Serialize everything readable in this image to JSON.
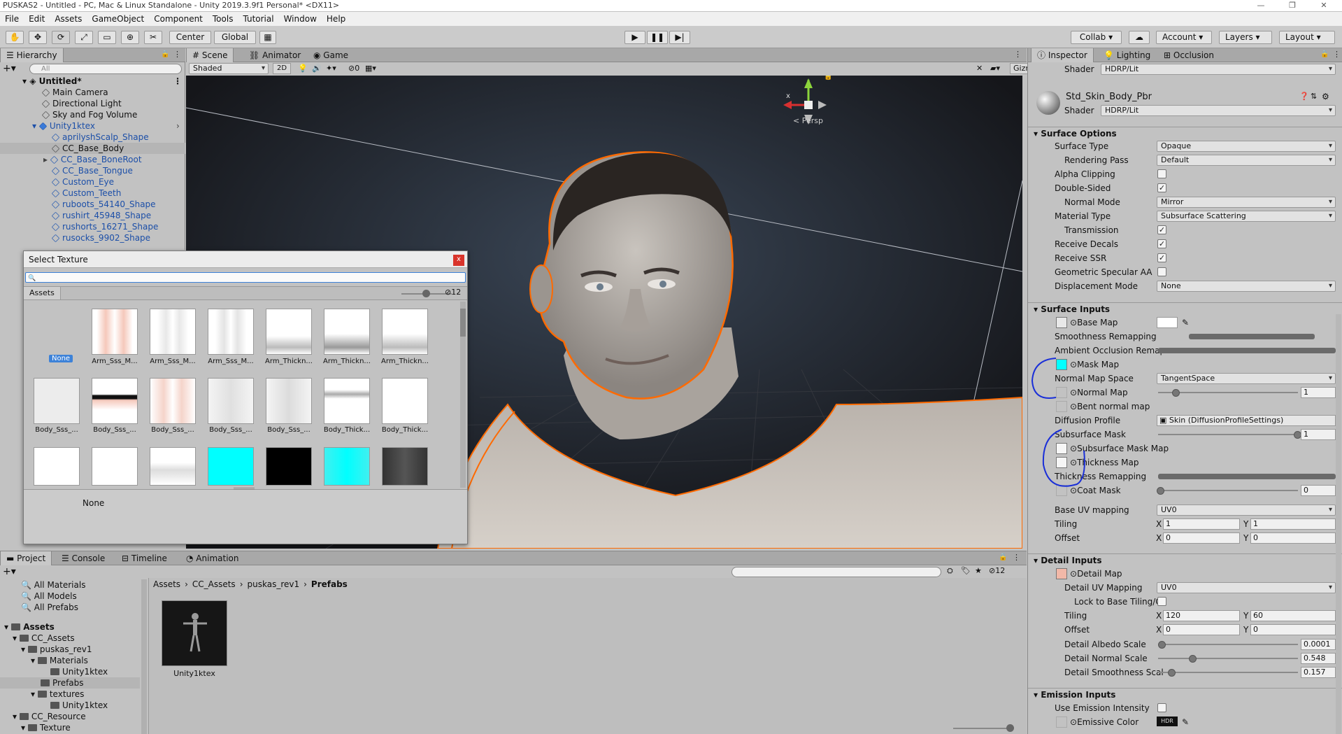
{
  "window": {
    "title": "PUSKAS2 - Untitled - PC, Mac & Linux Standalone - Unity 2019.3.9f1 Personal* <DX11>",
    "controls": [
      "—",
      "❐",
      "✕"
    ]
  },
  "menu": [
    "File",
    "Edit",
    "Assets",
    "GameObject",
    "Component",
    "Tools",
    "Tutorial",
    "Window",
    "Help"
  ],
  "toolbar": {
    "pivot": "Center",
    "space": "Global",
    "collab": "Collab ▾",
    "account": "Account",
    "layers": "Layers",
    "layout": "Layout"
  },
  "hierarchy": {
    "tab": "Hierarchy",
    "search_placeholder": "All",
    "scene": "Untitled*",
    "items": [
      {
        "label": "Main Camera",
        "blue": false
      },
      {
        "label": "Directional Light",
        "blue": false
      },
      {
        "label": "Sky and Fog Volume",
        "blue": false
      },
      {
        "label": "Unity1ktex",
        "blue": true
      },
      {
        "label": "aprilyshScalp_Shape",
        "blue": true
      },
      {
        "label": "CC_Base_Body",
        "blue": false
      },
      {
        "label": "CC_Base_BoneRoot",
        "blue": true
      },
      {
        "label": "CC_Base_Tongue",
        "blue": true
      },
      {
        "label": "Custom_Eye",
        "blue": true
      },
      {
        "label": "Custom_Teeth",
        "blue": true
      },
      {
        "label": "ruboots_54140_Shape",
        "blue": true
      },
      {
        "label": "rushirt_45948_Shape",
        "blue": true
      },
      {
        "label": "rushorts_16271_Shape",
        "blue": true
      },
      {
        "label": "rusocks_9902_Shape",
        "blue": true
      }
    ]
  },
  "scene_tabs": {
    "scene": "Scene",
    "animator": "Animator",
    "game": "Game",
    "shading": "Shaded",
    "mode_2d": "2D",
    "hidden_count": "0",
    "gizmos": "Gizmos",
    "search_placeholder": "All",
    "persp": "< Persp",
    "axis_x": "x",
    "axis_y": "y"
  },
  "dialog": {
    "title": "Select Texture",
    "close": "x",
    "assets_tab": "Assets",
    "count": "12",
    "selected_label": "None",
    "thumbnails": [
      {
        "label": "None",
        "selected": true
      },
      {
        "label": "Arm_Sss_M..."
      },
      {
        "label": "Arm_Sss_M..."
      },
      {
        "label": "Arm_Sss_M..."
      },
      {
        "label": "Arm_Thickn..."
      },
      {
        "label": "Arm_Thickn..."
      },
      {
        "label": "Arm_Thickn..."
      },
      {
        "label": "Body_Sss_..."
      },
      {
        "label": "Body_Sss_..."
      },
      {
        "label": "Body_Sss_..."
      },
      {
        "label": "Body_Sss_..."
      },
      {
        "label": "Body_Sss_..."
      },
      {
        "label": "Body_Thick..."
      },
      {
        "label": "Body_Thick..."
      }
    ]
  },
  "inspector": {
    "tabs": [
      "Inspector",
      "Lighting",
      "Occlusion"
    ],
    "shader_label": "Shader",
    "shader_top": "HDRP/Lit",
    "material_name": "Std_Skin_Body_Pbr",
    "shader_value": "HDRP/Lit",
    "surface_options": {
      "header": "Surface Options",
      "surface_type_label": "Surface Type",
      "surface_type": "Opaque",
      "rendering_pass_label": "Rendering Pass",
      "rendering_pass": "Default",
      "alpha_clipping_label": "Alpha Clipping",
      "double_sided_label": "Double-Sided",
      "normal_mode_label": "Normal Mode",
      "normal_mode": "Mirror",
      "material_type_label": "Material Type",
      "material_type": "Subsurface Scattering",
      "transmission_label": "Transmission",
      "receive_decals_label": "Receive Decals",
      "receive_ssr_label": "Receive SSR",
      "gsaa_label": "Geometric Specular AA",
      "displacement_label": "Displacement Mode",
      "displacement": "None"
    },
    "surface_inputs": {
      "header": "Surface Inputs",
      "base_map": "Base Map",
      "smoothness_remap": "Smoothness Remapping",
      "ao_remap": "Ambient Occlusion Remap",
      "mask_map": "Mask Map",
      "normal_space_label": "Normal Map Space",
      "normal_space": "TangentSpace",
      "normal_map": "Normal Map",
      "normal_value": "1",
      "bent_normal": "Bent normal map",
      "diffusion_label": "Diffusion Profile",
      "diffusion": "Skin (DiffusionProfileSettings)",
      "sss_mask_label": "Subsurface Mask",
      "sss_mask": "1",
      "sss_mask_map": "Subsurface Mask Map",
      "thickness_map": "Thickness Map",
      "thickness_remap": "Thickness Remapping",
      "coat_mask": "Coat Mask",
      "coat_value": "0",
      "base_uv_label": "Base UV mapping",
      "base_uv": "UV0",
      "tiling_label": "Tiling",
      "tiling_x": "1",
      "tiling_y": "1",
      "offset_label": "Offset",
      "offset_x": "0",
      "offset_y": "0",
      "x": "X",
      "y": "Y"
    },
    "detail_inputs": {
      "header": "Detail Inputs",
      "detail_map": "Detail Map",
      "detail_uv_label": "Detail UV Mapping",
      "detail_uv": "UV0",
      "lock_label": "Lock to Base Tiling/C",
      "tiling_label": "Tiling",
      "tiling_x": "120",
      "tiling_y": "60",
      "offset_label": "Offset",
      "offset_x": "0",
      "offset_y": "0",
      "albedo_label": "Detail Albedo Scale",
      "albedo": "0.0001",
      "normal_label": "Detail Normal Scale",
      "normal": "0.548",
      "smooth_label": "Detail Smoothness Scal",
      "smooth": "0.157"
    },
    "emission_inputs": {
      "header": "Emission Inputs",
      "use_intensity": "Use Emission Intensity",
      "emissive_color": "Emissive Color",
      "hdr": "HDR"
    }
  },
  "project": {
    "tabs": [
      "Project",
      "Console",
      "Timeline",
      "Animation"
    ],
    "count": "12",
    "favorites": [
      "All Materials",
      "All Models",
      "All Prefabs"
    ],
    "tree": [
      {
        "label": "Assets",
        "bold": true,
        "indent": 0
      },
      {
        "label": "CC_Assets",
        "indent": 1
      },
      {
        "label": "puskas_rev1",
        "indent": 2
      },
      {
        "label": "Materials",
        "indent": 3
      },
      {
        "label": "Unity1ktex",
        "indent": 4
      },
      {
        "label": "Prefabs",
        "indent": 3,
        "selected": true
      },
      {
        "label": "textures",
        "indent": 3
      },
      {
        "label": "Unity1ktex",
        "indent": 4
      },
      {
        "label": "CC_Resource",
        "indent": 1
      },
      {
        "label": "Texture",
        "indent": 2
      }
    ],
    "breadcrumb": [
      "Assets",
      "CC_Assets",
      "puskas_rev1",
      "Prefabs"
    ],
    "asset_label": "Unity1ktex"
  },
  "colors": {
    "accent_blue": "#1c4fa8",
    "selection_orange": "#ff6a00",
    "mask_map_cyan": "#00ffff",
    "detail_map_pink": "#f2b8a8"
  }
}
